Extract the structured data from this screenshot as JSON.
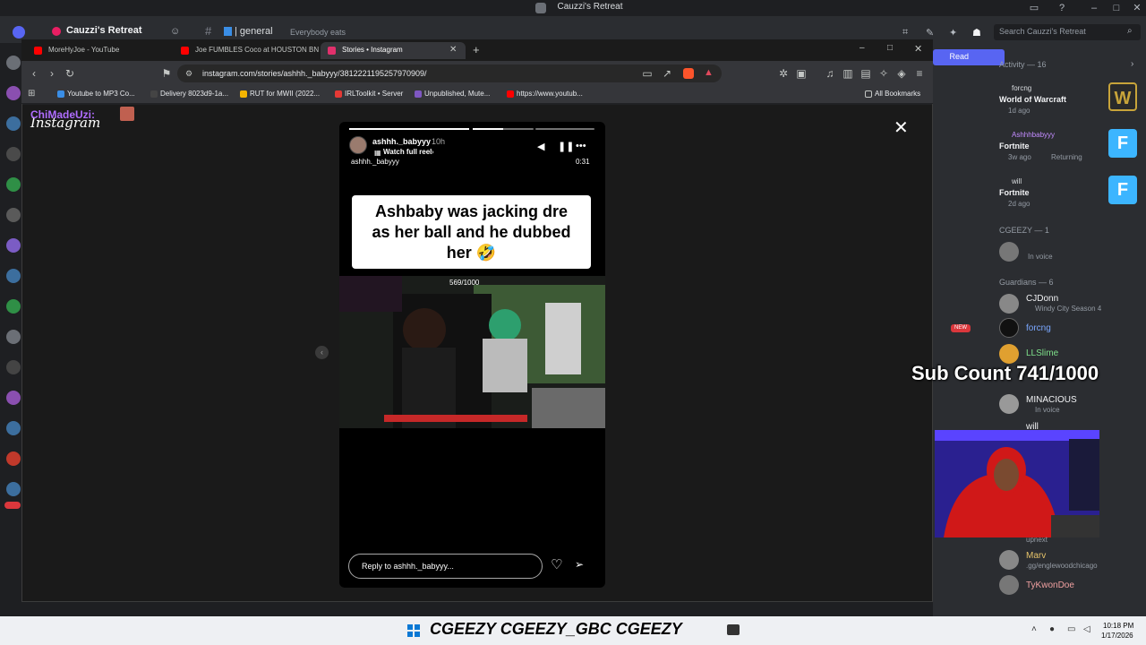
{
  "discord": {
    "window_title": "Cauzzi's Retreat",
    "server_name": "Cauzzi's Retreat",
    "channel_name": "| general",
    "channel_topic": "Everybody eats",
    "search_placeholder": "Search Cauzzi's Retreat",
    "read_button": "Read",
    "activity_header": "Activity — 16",
    "activities": [
      {
        "name": "forcng",
        "game": "World of Warcraft",
        "time": "1d ago",
        "art": "W",
        "color": "#c8a43a"
      },
      {
        "name": "Ashhhbabyyy",
        "game": "Fortnite",
        "time": "3w ago",
        "extra": "Returning",
        "art": "F",
        "color": "#3cb5ff"
      },
      {
        "name": "will",
        "game": "Fortnite",
        "time": "2d ago",
        "art": "F",
        "color": "#3cb5ff"
      }
    ],
    "groups": [
      {
        "header": "CGEEZY — 1",
        "members": [
          {
            "name": "cgeezy",
            "status": "In voice"
          }
        ]
      },
      {
        "header": "Guardians — 6",
        "members": [
          {
            "name": "CJDonn",
            "status": "Windy City Season 4"
          },
          {
            "name": "forcng",
            "status": ""
          },
          {
            "name": "LLSlime",
            "status": ""
          },
          {
            "name": "MINACIOUS",
            "status": "In voice"
          },
          {
            "name": "will",
            "status": ""
          }
        ]
      }
    ],
    "bottom_members": [
      {
        "name": "Marv",
        "status": ".gg/englewoodchicago"
      },
      {
        "name": "TyKwonDoe",
        "status": ""
      }
    ],
    "new_badge": "NEW",
    "mid_label": "upnext"
  },
  "overlay": {
    "chat_name": "ChiMadeUzi:",
    "sub_count": "Sub Count 741/1000",
    "social_text": "CGEEZY  CGEEZY_GBC  CGEEZY"
  },
  "browser": {
    "tabs": [
      {
        "label": "MoreHyJoe - YouTube",
        "color": "#ff0000"
      },
      {
        "label": "Joe FUMBLES Coco at HOUSTON BN",
        "color": "#ff0000"
      },
      {
        "label": "Stories • Instagram",
        "color": "#e1306c"
      }
    ],
    "new_tab": "+",
    "url": "instagram.com/stories/ashhh._babyyy/3812221195257970909/",
    "bookmarks": [
      {
        "label": "Youtube to MP3 Co...",
        "color": "#3a8ee6"
      },
      {
        "label": "Delivery 8023d9-1a...",
        "color": "#444444"
      },
      {
        "label": "RUT for MWII (2022...",
        "color": "#f4b400"
      },
      {
        "label": "IRLToolkit • Server",
        "color": "#e53935"
      },
      {
        "label": "Unpublished, Mute...",
        "color": "#7e57c2"
      },
      {
        "label": "https://www.youtub...",
        "color": "#ff0000"
      }
    ],
    "all_bookmarks": "All Bookmarks"
  },
  "instagram": {
    "logo": "Instagram",
    "close": "✕",
    "story": {
      "username": "ashhh._babyyy",
      "age": "10h",
      "watch_full_reel": "Watch full reel",
      "sub_username": "ashhh._babyyy",
      "time_remaining": "0:31",
      "caption_line1": "Ashbaby was jacking dre",
      "caption_line2": "as her ball and he dubbed",
      "caption_line3": "her 🤣",
      "video_overlay": "569/1000",
      "progress_segments": [
        1.0,
        0.5,
        0.0
      ]
    },
    "reply_placeholder": "Reply to ashhh._babyyy..."
  },
  "taskbar": {
    "time": "10:18 PM",
    "date": "1/17/2026"
  },
  "colors": {
    "discord_bg": "#1e1f22",
    "discord_panel": "#2b2d31",
    "discord_accent": "#5865f2",
    "instagram_pink": "#e1306c"
  }
}
